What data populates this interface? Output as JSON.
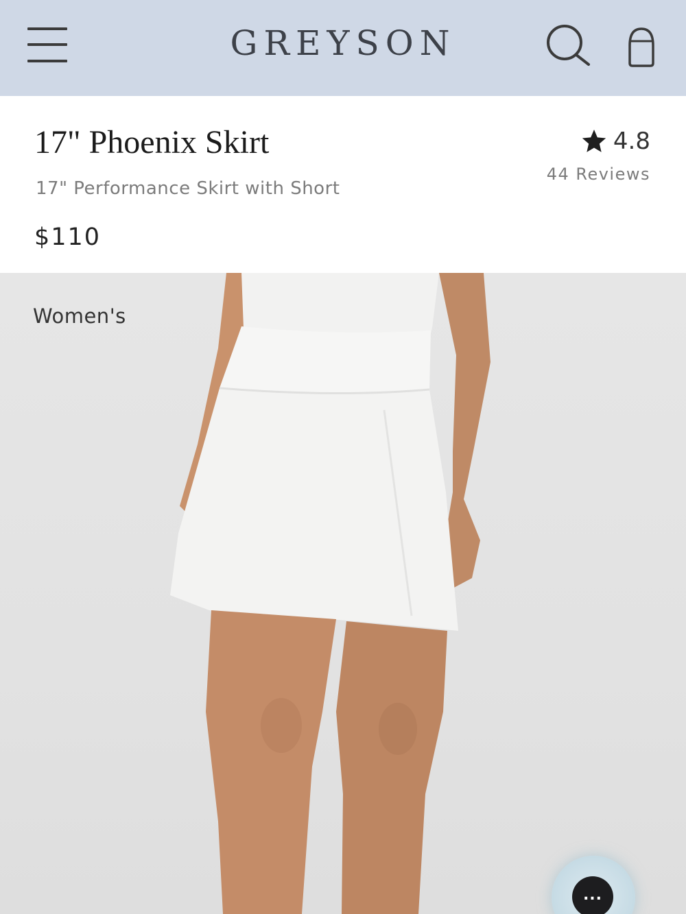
{
  "header": {
    "logo": "GREYSON",
    "menu_icon": "hamburger-menu-icon",
    "search_icon": "search-icon",
    "cart_icon": "shopping-bag-icon",
    "background_color": "#cfd8e6"
  },
  "product": {
    "title": "17\" Phoenix Skirt",
    "subtitle": "17\" Performance Skirt with Short",
    "price": "$110",
    "rating": "4.8",
    "reviews": "44 Reviews",
    "rating_icon": "star-icon"
  },
  "hero": {
    "category_label": "Women's"
  },
  "chat": {
    "icon": "chat-bubble-icon",
    "label": "..."
  }
}
